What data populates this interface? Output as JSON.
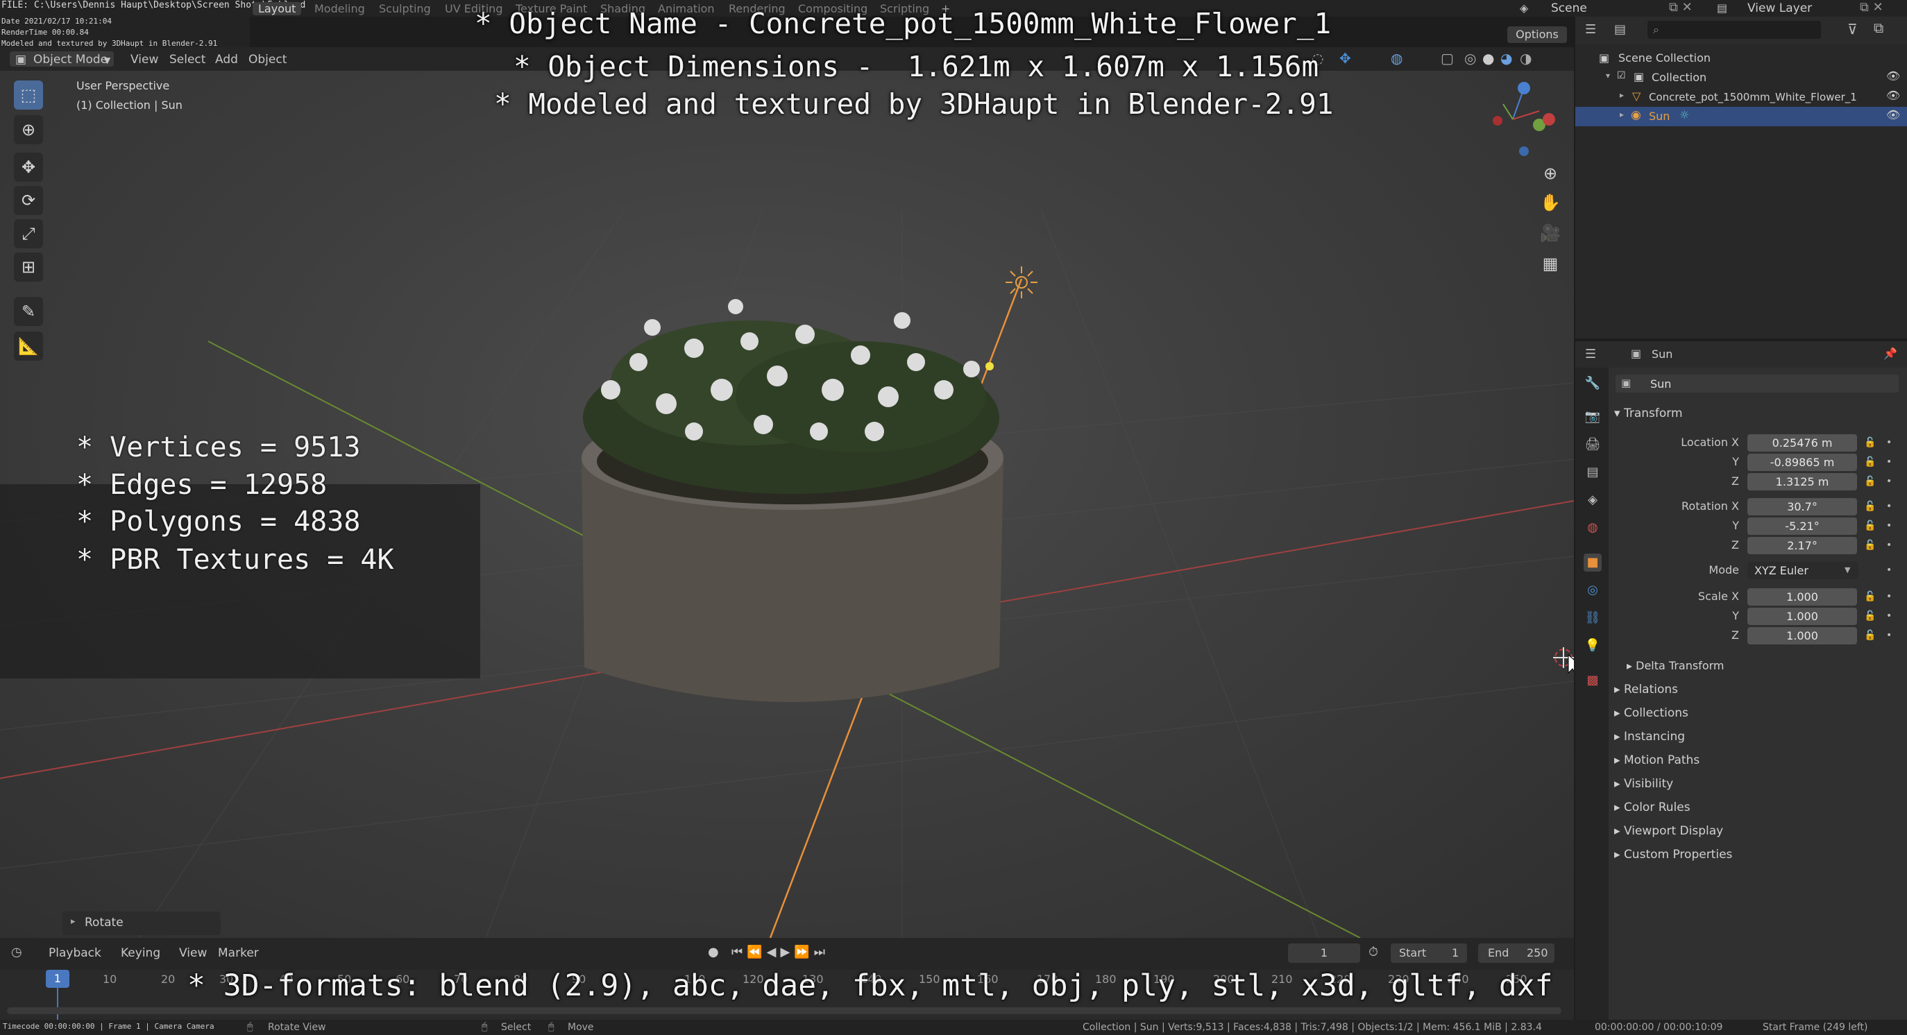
{
  "topbar": {
    "file_path": "FILE: C:\\Users\\Dennis Haupt\\Desktop\\Screen Shots\\5.blend",
    "tabs": [
      "Layout",
      "Modeling",
      "Sculpting",
      "UV Editing",
      "Texture Paint",
      "Shading",
      "Animation",
      "Rendering",
      "Compositing",
      "Scripting"
    ],
    "add": "+",
    "scene": "Scene",
    "view_layer": "View Layer"
  },
  "stamp": {
    "date": "Date 2021/02/17 10:21:04",
    "rendertime": "RenderTime 00:00.84",
    "note": "Modeled and textured by 3DHaupt in Blender-2.91"
  },
  "viewport_header": {
    "mode": "Object Mode",
    "menus": [
      "View",
      "Select",
      "Add",
      "Object"
    ],
    "options": "Options"
  },
  "viewport": {
    "perspective": "User Perspective",
    "collection": "(1) Collection | Sun",
    "caption_lines": [
      "* Object Name - Concrete_pot_1500mm_White_Flower_1",
      "* Object Dimensions -  1.621m x 1.607m x 1.156m",
      "* Modeled and textured by 3DHaupt in Blender-2.91"
    ],
    "stats": [
      "* Vertices = 9513",
      "* Edges = 12958",
      "* Polygons = 4838",
      "* PBR Textures = 4K"
    ],
    "operator_panel": "Rotate",
    "formats": "* 3D-formats: blend (2.9), abc, dae, fbx, mtl, obj, ply, stl, x3d, gltf, dxf"
  },
  "outliner": {
    "root": "Scene Collection",
    "items": [
      "Collection",
      "Concrete_pot_1500mm_White_Flower_1",
      "Sun"
    ]
  },
  "properties": {
    "header_object": "Sun",
    "object_name": "Sun",
    "transform": {
      "title": "Transform",
      "location_label": "Location X",
      "location": [
        "0.25476 m",
        "-0.89865 m",
        "1.3125 m"
      ],
      "rotation_label": "Rotation X",
      "rotation": [
        "30.7°",
        "-5.21°",
        "2.17°"
      ],
      "mode_label": "Mode",
      "mode": "XYZ Euler",
      "scale_label": "Scale X",
      "scale": [
        "1.000",
        "1.000",
        "1.000"
      ],
      "y": "Y",
      "z": "Z"
    },
    "delta": "Delta Transform",
    "sections": [
      "Relations",
      "Collections",
      "Instancing",
      "Motion Paths",
      "Visibility",
      "Color Rules",
      "Viewport Display",
      "Custom Properties"
    ]
  },
  "timeline": {
    "menus": [
      "Playback",
      "Keying",
      "View",
      "Marker"
    ],
    "current_frame": "1",
    "start_label": "Start",
    "start": "1",
    "end_label": "End",
    "end": "250",
    "ticks": [
      "1",
      "10",
      "20",
      "30",
      "40",
      "50",
      "60",
      "70",
      "80",
      "90",
      "110",
      "120",
      "130",
      "140",
      "150",
      "160",
      "170",
      "180",
      "190",
      "200",
      "210",
      "220",
      "230",
      "240",
      "250"
    ]
  },
  "statusbar": {
    "left": "Timecode 00:00:00:00 | Frame 1 | Camera Camera",
    "rotate": "Rotate View",
    "select": "Select",
    "move": "Move",
    "info": "Collection | Sun | Verts:9,513 | Faces:4,838 | Tris:7,498 | Objects:1/2 | Mem: 456.1 MiB | 2.83.4",
    "time": "00:00:00:00 / 00:00:10:09",
    "start_frame": "Start Frame (249 left)"
  },
  "icons": {
    "select": "cursor-box-icon",
    "cursor": "3d-cursor-icon",
    "move": "move-icon",
    "rotate": "rotate-icon",
    "scale": "scale-icon",
    "transform": "transform-icon",
    "annotate": "annotate-icon",
    "measure": "measure-icon"
  },
  "colors": {
    "accent": "#4a6b99",
    "selection": "#334d80",
    "light": "#e8a040"
  }
}
